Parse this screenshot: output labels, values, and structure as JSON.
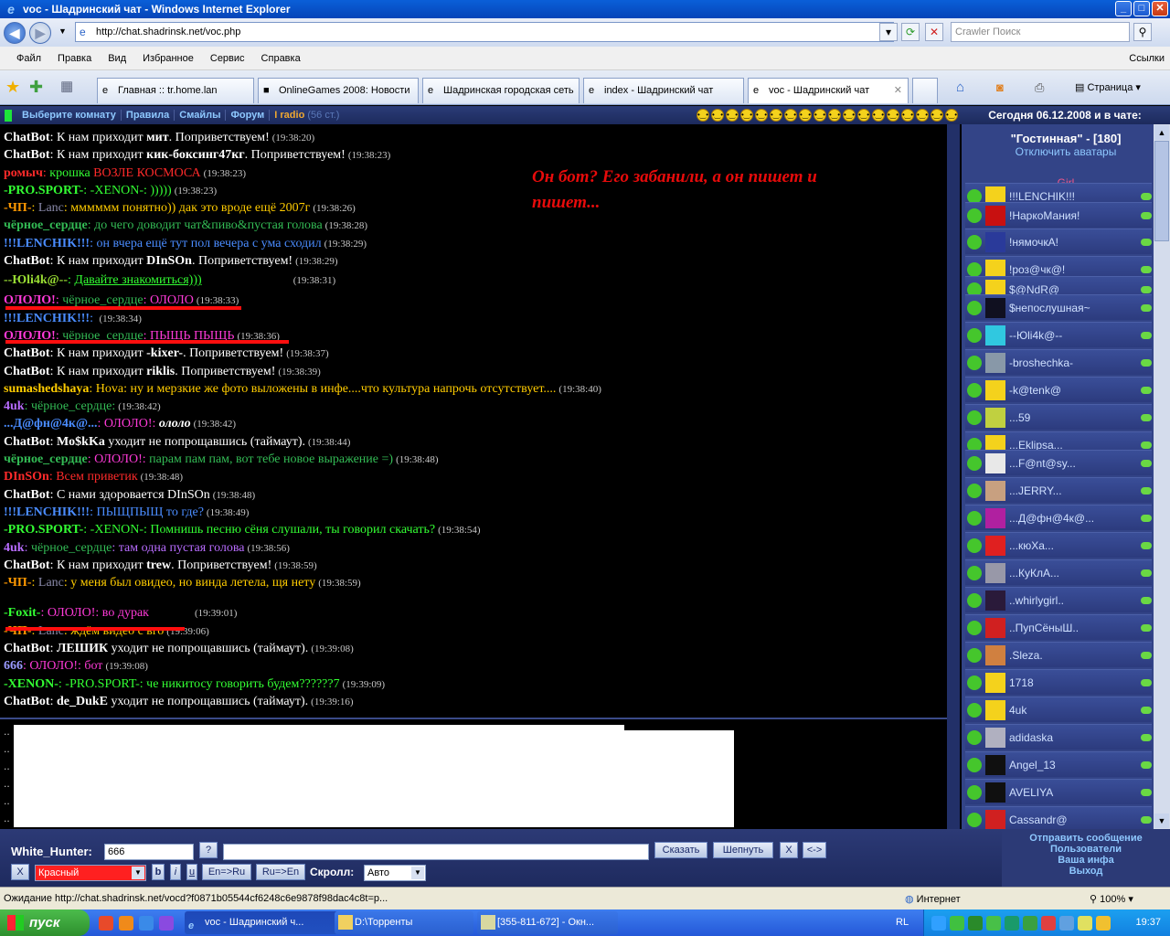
{
  "window": {
    "title": "voc - Шадринский чат - Windows Internet Explorer",
    "url": "http://chat.shadrinsk.net/voc.php",
    "search_placeholder": "Crawler Поиск"
  },
  "menu": {
    "items": [
      "Файл",
      "Правка",
      "Вид",
      "Избранное",
      "Сервис",
      "Справка"
    ],
    "links": "Ссылки"
  },
  "tabs": [
    {
      "label": "Главная :: tr.home.lan"
    },
    {
      "label": "OnlineGames 2008: Новости"
    },
    {
      "label": "Шадринская городская сеть"
    },
    {
      "label": "index - Шадринский чат"
    },
    {
      "label": "voc - Шадринский чат"
    }
  ],
  "toolbar": {
    "page_label": "Страница"
  },
  "chatnav": {
    "items": [
      "Выберите комнату",
      "Правила",
      "Смайлы",
      "Форум"
    ],
    "radio": "I radio",
    "radio_count": "(56 ст.)",
    "today": "Сегодня 06.12.2008 и в чате:"
  },
  "note": "Он бот? Его забанили, а он пишет и пишет...",
  "messages": [
    {
      "nick": "ChatBot",
      "nick_color": "#ffffff",
      "text": ": К нам приходит ",
      "bold": "мит",
      "rest": ". Поприветствуем!",
      "text_color": "#ffffff",
      "time": "(19:38:20)"
    },
    {
      "nick": "ChatBot",
      "nick_color": "#ffffff",
      "text": ": К нам приходит ",
      "bold": "кик-боксинг47кг",
      "rest": ". Поприветствуем!",
      "text_color": "#ffffff",
      "time": "(19:38:23)"
    },
    {
      "nick": "ромыч",
      "nick_color": "#ff2a2a",
      "text": ": ",
      "sender_text": "крошка",
      "sender_color": "#33ff33",
      "rest": " ВОЗЛЕ КОСМОСА",
      "text_color": "#ff2a2a",
      "time": "(19:38:23)"
    },
    {
      "nick": "-PRO.SPORT-",
      "nick_color": "#33ff33",
      "text": ": -XENON-: )))))",
      "text_color": "#33ff33",
      "time": "(19:38:23)"
    },
    {
      "nick": "-ЧП-",
      "nick_color": "#ff9900",
      "text": ": ",
      "sender_text": "Lanc",
      "sender_color": "#8a8aaa",
      "rest": ": мммммм понятно)) дак это вроде ещё 2007г",
      "text_color": "#ffcc00",
      "time": "(19:38:26)"
    },
    {
      "nick": "чёрное_сердце",
      "nick_color": "#33bb55",
      "text": ": до чего доводит чат&пиво&пустая голова",
      "text_color": "#33bb55",
      "time": "(19:38:28)"
    },
    {
      "nick": "!!!LENCHIK!!!",
      "nick_color": "#4a8cff",
      "text": ": он вчера ещё тут пол вечера с ума сходил",
      "text_color": "#4a8cff",
      "time": "(19:38:29)"
    },
    {
      "nick": "ChatBot",
      "nick_color": "#ffffff",
      "text": ": К нам приходит ",
      "bold": "DInSOn",
      "rest": ". Поприветствуем!",
      "text_color": "#ffffff",
      "time": "(19:38:29)"
    },
    {
      "nick": "--Юli4k@--",
      "nick_color": "#99dd33",
      "text": ": ",
      "sender_text": "Давайте знакомиться)))",
      "sender_color": "#33ff33",
      "rest": "",
      "text_color": "#33ff33",
      "time": "(19:38:31)"
    },
    {
      "nick": "ОЛОЛО!",
      "nick_color": "#ff3ad8",
      "text": ": ",
      "sender_text": "чёрное_сердце",
      "sender_color": "#33bb55",
      "rest": ": ОЛОЛО",
      "text_color": "#ff3ad8",
      "time": "(19:38:33)"
    },
    {
      "nick": "!!!LENCHIK!!!",
      "nick_color": "#4a8cff",
      "text": ": ",
      "text_color": "#4a8cff",
      "time": "(19:38:34)"
    },
    {
      "nick": "ОЛОЛО!",
      "nick_color": "#ff3ad8",
      "text": ": ",
      "sender_text": "чёрное_сердце",
      "sender_color": "#33bb55",
      "rest": ": ПЫЩЬ ПЫЩЬ",
      "text_color": "#ff3ad8",
      "time": "(19:38:36)"
    },
    {
      "nick": "ChatBot",
      "nick_color": "#ffffff",
      "text": ": К нам приходит ",
      "bold": "-kixer-",
      "rest": ". Поприветствуем!",
      "text_color": "#ffffff",
      "time": "(19:38:37)"
    },
    {
      "nick": "ChatBot",
      "nick_color": "#ffffff",
      "text": ": К нам приходит ",
      "bold": "riklis",
      "rest": ". Поприветствуем!",
      "text_color": "#ffffff",
      "time": "(19:38:39)"
    },
    {
      "nick": "sumashedshaya",
      "nick_color": "#ffcc00",
      "text": ": Hova: ну и мерзкие же фото выложены в инфе....что культура напрочь отсутствует....",
      "text_color": "#ffcc00",
      "time": "(19:38:40)"
    },
    {
      "nick": "4uk",
      "nick_color": "#b86cff",
      "text": ": ",
      "sender_text": "чёрное_сердце",
      "sender_color": "#33bb55",
      "rest": ":",
      "text_color": "#33bb55",
      "time": "(19:38:42)"
    },
    {
      "nick": "...Д@фн@4к@...",
      "nick_color": "#4a8cff",
      "text": ": ОЛОЛО!: ",
      "sender_text": "ололо",
      "sender_color": "#ffffff",
      "rest": "",
      "text_color": "#ff3ad8",
      "time": "(19:38:42)"
    },
    {
      "nick": "ChatBot",
      "nick_color": "#ffffff",
      "text": ": ",
      "bold": "Mo$kKa",
      "rest": " уходит не попрощавшись (таймаут).",
      "text_color": "#ffffff",
      "time": "(19:38:44)"
    },
    {
      "nick": "чёрное_сердце",
      "nick_color": "#33bb55",
      "text": ": ОЛОЛО!: ",
      "rest": "парам пам пам, вот тебе новое выражение =)",
      "text_color": "#ff3ad8",
      "rest_color": "#33bb55",
      "time": "(19:38:48)"
    },
    {
      "nick": "DInSOn",
      "nick_color": "#ff2a2a",
      "text": ": Всем приветик",
      "text_color": "#ff2a2a",
      "time": "(19:38:48)"
    },
    {
      "nick": "ChatBot",
      "nick_color": "#ffffff",
      "text": ": С нами здоровается DInSOn",
      "text_color": "#ffffff",
      "time": "(19:38:48)"
    },
    {
      "nick": "!!!LENCHIK!!!",
      "nick_color": "#4a8cff",
      "text": ": ПЫЩПЫЩ то где?",
      "text_color": "#4a8cff",
      "time": "(19:38:49)"
    },
    {
      "nick": "-PRO.SPORT-",
      "nick_color": "#33ff33",
      "text": ": -XENON-: Помнишь песню сёня слушали, ты говорил скачать?",
      "text_color": "#33ff33",
      "time": "(19:38:54)"
    },
    {
      "nick": "4uk",
      "nick_color": "#b86cff",
      "text": ": ",
      "sender_text": "чёрное_сердце",
      "sender_color": "#33bb55",
      "rest": ": там одна пустая голова",
      "text_color": "#b86cff",
      "time": "(19:38:56)"
    },
    {
      "nick": "ChatBot",
      "nick_color": "#ffffff",
      "text": ": К нам приходит ",
      "bold": "trew",
      "rest": ". Поприветствуем!",
      "text_color": "#ffffff",
      "time": "(19:38:59)"
    },
    {
      "nick": "-ЧП-",
      "nick_color": "#ff9900",
      "text": ": ",
      "sender_text": "Lanc",
      "sender_color": "#8a8aaa",
      "rest": ": у меня был овидео, но винда летела, щя нету",
      "text_color": "#ffcc00",
      "time": "(19:38:59)"
    },
    {
      "nick": "-Foxit-",
      "nick_color": "#33ff33",
      "text": ": ОЛОЛО!: во дурак",
      "text_color": "#ff3ad8",
      "time": "(19:39:01)"
    },
    {
      "nick": "-ЧП-",
      "nick_color": "#ff9900",
      "text": ": ",
      "sender_text": "Lanc",
      "sender_color": "#8a8aaa",
      "rest": ": ждём видео с вго",
      "text_color": "#ffcc00",
      "time": "(19:39:06)"
    },
    {
      "nick": "ChatBot",
      "nick_color": "#ffffff",
      "text": ": ",
      "bold": "ЛЕШИК",
      "rest": " уходит не попрощавшись (таймаут).",
      "text_color": "#ffffff",
      "time": "(19:39:08)"
    },
    {
      "nick": "666",
      "nick_color": "#9999ff",
      "text": ": ОЛОЛО!: бот",
      "text_color": "#ff3ad8",
      "time": "(19:39:08)"
    },
    {
      "nick": "-XENON-",
      "nick_color": "#33ff33",
      "text": ": -PRO.SPORT-: че никитосу говорить будем??????7",
      "text_color": "#33ff33",
      "time": "(19:39:09)"
    },
    {
      "nick": "ChatBot",
      "nick_color": "#ffffff",
      "text": ": ",
      "bold": "de_DukE",
      "rest": " уходит не попрощавшись (таймаут).",
      "text_color": "#ffffff",
      "time": "(19:39:16)"
    }
  ],
  "userlist": {
    "room": "\"Гостинная\" - [180]",
    "avatars_off": "Отключить аватары",
    "group": "Girl",
    "users": [
      "!!!LENCHIK!!!",
      "!НаркоМания!",
      "!нямочкА!",
      "!роз@чк@!",
      "$@NdR@",
      "$непослушная~",
      "--Юli4k@--",
      "-broshechka-",
      "-k@tenk@",
      "...59",
      "...Eklipsa...",
      "...F@nt@sy...",
      "...JERRY...",
      "...Д@фн@4к@...",
      "...кюХа...",
      "...КуКлА...",
      "..whirlygirl..",
      "..ПупСёныШ..",
      ".Sleza.",
      "1718",
      "4uk",
      "adidaska",
      "Angel_13",
      "AVELIYA",
      "Cassandr@"
    ]
  },
  "input": {
    "me": "White_Hunter:",
    "to_value": "666",
    "help_btn": "?",
    "say_btn": "Сказать",
    "whisper_btn": "Шепнуть",
    "x_btn": "X",
    "swap_btn": "<->",
    "color_x": "X",
    "color_value": "Красный",
    "bold_btn": "b",
    "italic_btn": "i",
    "underline_btn": "u",
    "en_ru": "En=>Ru",
    "ru_en": "Ru=>En",
    "scroll_label": "Скролл:",
    "scroll_value": "Авто"
  },
  "actions": [
    "Отправить сообщение",
    "Пользователи",
    "Ваша инфа",
    "Выход"
  ],
  "status": {
    "text": "Ожидание http://chat.shadrinsk.net/vocd?f0871b05544cf6248c6e9878f98dac4c8t=p...",
    "zone": "Интернет",
    "zoom": "100%"
  },
  "taskbar": {
    "start": "пуск",
    "buttons": [
      "voc - Шадринский ч...",
      "D:\\Торренты",
      "[355-811-672] - Окн..."
    ],
    "lang": "RL",
    "clock": "19:37"
  }
}
